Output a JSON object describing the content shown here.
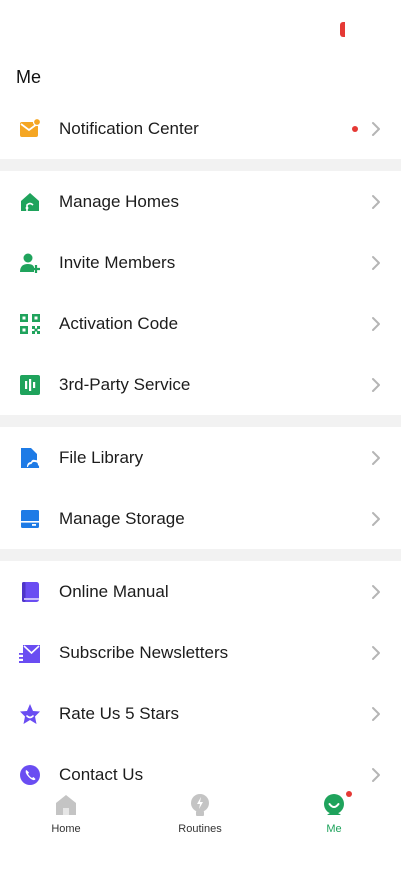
{
  "header": {
    "title": "Me"
  },
  "menu": {
    "notification": {
      "label": "Notification Center",
      "icon": "mail-icon",
      "color": "#f5a623"
    },
    "group1": [
      {
        "label": "Manage Homes",
        "icon": "home-icon",
        "color": "#1fa35c"
      },
      {
        "label": "Invite Members",
        "icon": "add-member-icon",
        "color": "#1fa35c"
      },
      {
        "label": "Activation Code",
        "icon": "qr-code-icon",
        "color": "#1fa35c"
      },
      {
        "label": "3rd-Party Service",
        "icon": "service-icon",
        "color": "#1fa35c"
      }
    ],
    "group2": [
      {
        "label": "File Library",
        "icon": "cloud-file-icon",
        "color": "#1e7be6"
      },
      {
        "label": "Manage Storage",
        "icon": "storage-icon",
        "color": "#1e7be6"
      }
    ],
    "group3": [
      {
        "label": "Online Manual",
        "icon": "book-icon",
        "color": "#6a4df2"
      },
      {
        "label": "Subscribe Newsletters",
        "icon": "newsletter-icon",
        "color": "#6a4df2"
      },
      {
        "label": "Rate Us 5 Stars",
        "icon": "star-icon",
        "color": "#6a4df2"
      },
      {
        "label": "Contact Us",
        "icon": "phone-icon",
        "color": "#6a4df2"
      }
    ]
  },
  "tabs": [
    {
      "label": "Home",
      "icon": "home-tab-icon"
    },
    {
      "label": "Routines",
      "icon": "routines-tab-icon"
    },
    {
      "label": "Me",
      "icon": "me-tab-icon",
      "active": true
    }
  ]
}
